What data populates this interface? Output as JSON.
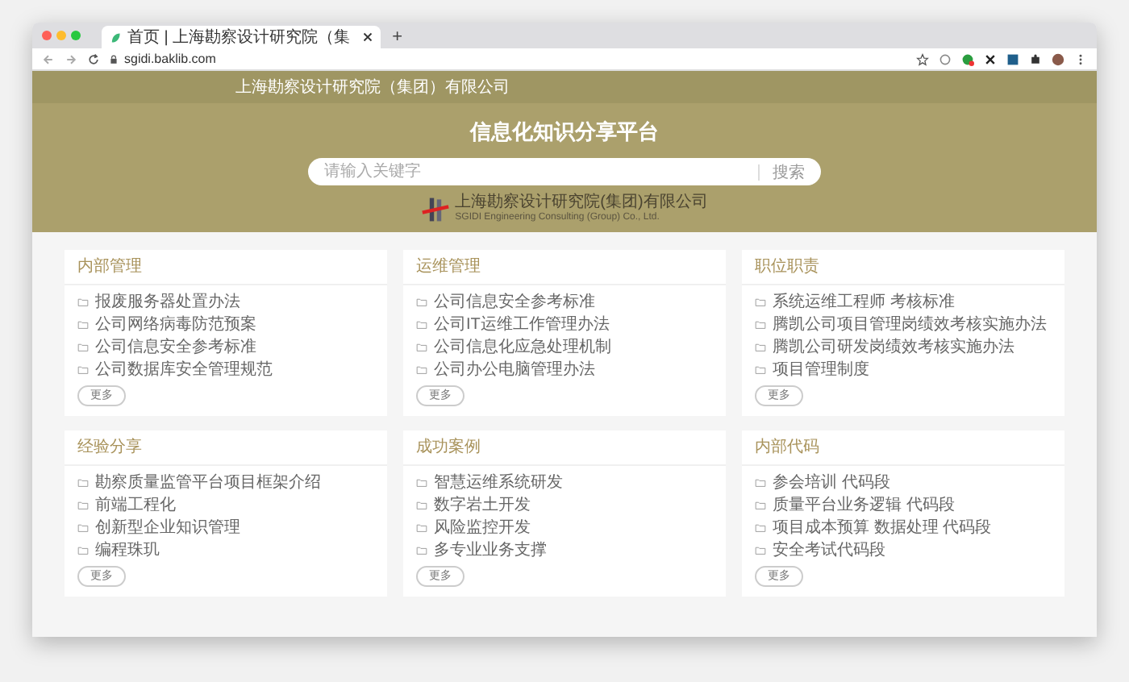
{
  "browser": {
    "tab": {
      "title": "首页 | 上海勘察设计研究院（集",
      "selected": true
    },
    "new_tab": "+",
    "address": "sgidi.baklib.com"
  },
  "header": {
    "company": "上海勘察设计研究院（集团）有限公司",
    "title": "信息化知识分享平台",
    "search": {
      "placeholder": "请输入关键字",
      "button": "搜索"
    },
    "logo": {
      "name": "上海勘察设计研究院(集团)有限公司",
      "english": "SGIDI Engineering Consulting (Group) Co., Ltd."
    }
  },
  "sections": [
    {
      "title": "内部管理",
      "items": [
        "报废服务器处置办法",
        "公司网络病毒防范预案",
        "公司信息安全参考标准",
        "公司数据库安全管理规范"
      ],
      "more": "更多"
    },
    {
      "title": "运维管理",
      "items": [
        "公司信息安全参考标准",
        "公司IT运维工作管理办法",
        "公司信息化应急处理机制",
        "公司办公电脑管理办法"
      ],
      "more": "更多"
    },
    {
      "title": "职位职责",
      "items": [
        "系统运维工程师 考核标准",
        "腾凯公司项目管理岗绩效考核实施办法",
        "腾凯公司研发岗绩效考核实施办法",
        "项目管理制度"
      ],
      "more": "更多"
    },
    {
      "title": "经验分享",
      "items": [
        "勘察质量监管平台项目框架介绍",
        "前端工程化",
        "创新型企业知识管理",
        "编程珠玑"
      ],
      "more": "更多"
    },
    {
      "title": "成功案例",
      "items": [
        "智慧运维系统研发",
        "数字岩土开发",
        "风险监控开发",
        "多专业业务支撑"
      ],
      "more": "更多"
    },
    {
      "title": "内部代码",
      "items": [
        "参会培训 代码段",
        "质量平台业务逻辑 代码段",
        "项目成本预算 数据处理 代码段",
        "安全考试代码段"
      ],
      "more": "更多"
    }
  ]
}
